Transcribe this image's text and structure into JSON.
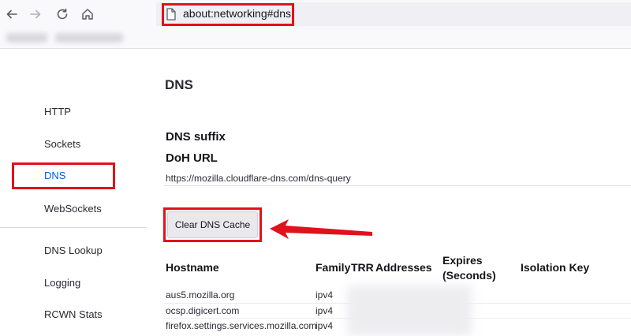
{
  "browser": {
    "url": "about:networking#dns",
    "icons": {
      "back": "arrow-left-icon",
      "forward": "arrow-right-icon",
      "reload": "reload-icon",
      "home": "home-icon",
      "page": "page-icon"
    },
    "highlight_color": "#e0121c"
  },
  "sidebar": {
    "items": [
      {
        "label": "HTTP",
        "selected": false
      },
      {
        "label": "Sockets",
        "selected": false
      },
      {
        "label": "DNS",
        "selected": true
      },
      {
        "label": "WebSockets",
        "selected": false
      },
      {
        "label": "DNS Lookup",
        "selected": false
      },
      {
        "label": "Logging",
        "selected": false
      },
      {
        "label": "RCWN Stats",
        "selected": false
      }
    ],
    "selected_color": "#0061e0"
  },
  "main": {
    "title": "DNS",
    "dns_suffix_label": "DNS suffix",
    "doh_url_label": "DoH URL",
    "doh_url_value": "https://mozilla.cloudflare-dns.com/dns-query",
    "clear_button_label": "Clear DNS Cache",
    "table": {
      "headers": {
        "hostname": "Hostname",
        "family": "Family",
        "trr": "TRR",
        "addresses": "Addresses",
        "expires_line1": "Expires",
        "expires_line2": "(Seconds)",
        "isolation": "Isolation Key"
      },
      "rows": [
        {
          "hostname": "aus5.mozilla.org",
          "family": "ipv4"
        },
        {
          "hostname": "ocsp.digicert.com",
          "family": "ipv4"
        },
        {
          "hostname": "firefox.settings.services.mozilla.com",
          "family": "ipv4"
        }
      ]
    }
  }
}
